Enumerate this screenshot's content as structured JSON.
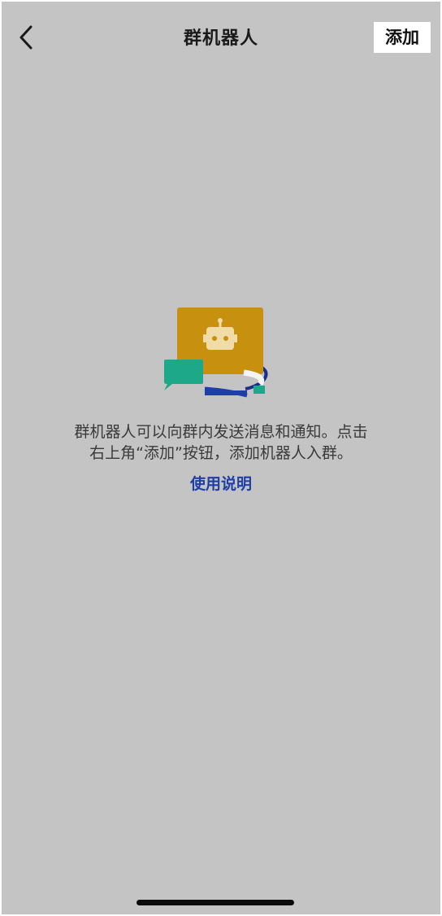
{
  "header": {
    "title": "群机器人",
    "add_label": "添加",
    "back_icon": "chevron-left-icon"
  },
  "empty_state": {
    "illustration": "robot-chat-illustration",
    "description_line1": "群机器人可以向群内发送消息和通知。点击",
    "description_line2": "右上角“添加”按钮，添加机器人入群。",
    "help_link": "使用说明"
  },
  "colors": {
    "background": "#c4c4c4",
    "robot_card": "#c8900f",
    "chat_bubble": "#1ea88a",
    "accent_blue": "#1f3fa8",
    "link": "#1f3fa8"
  }
}
